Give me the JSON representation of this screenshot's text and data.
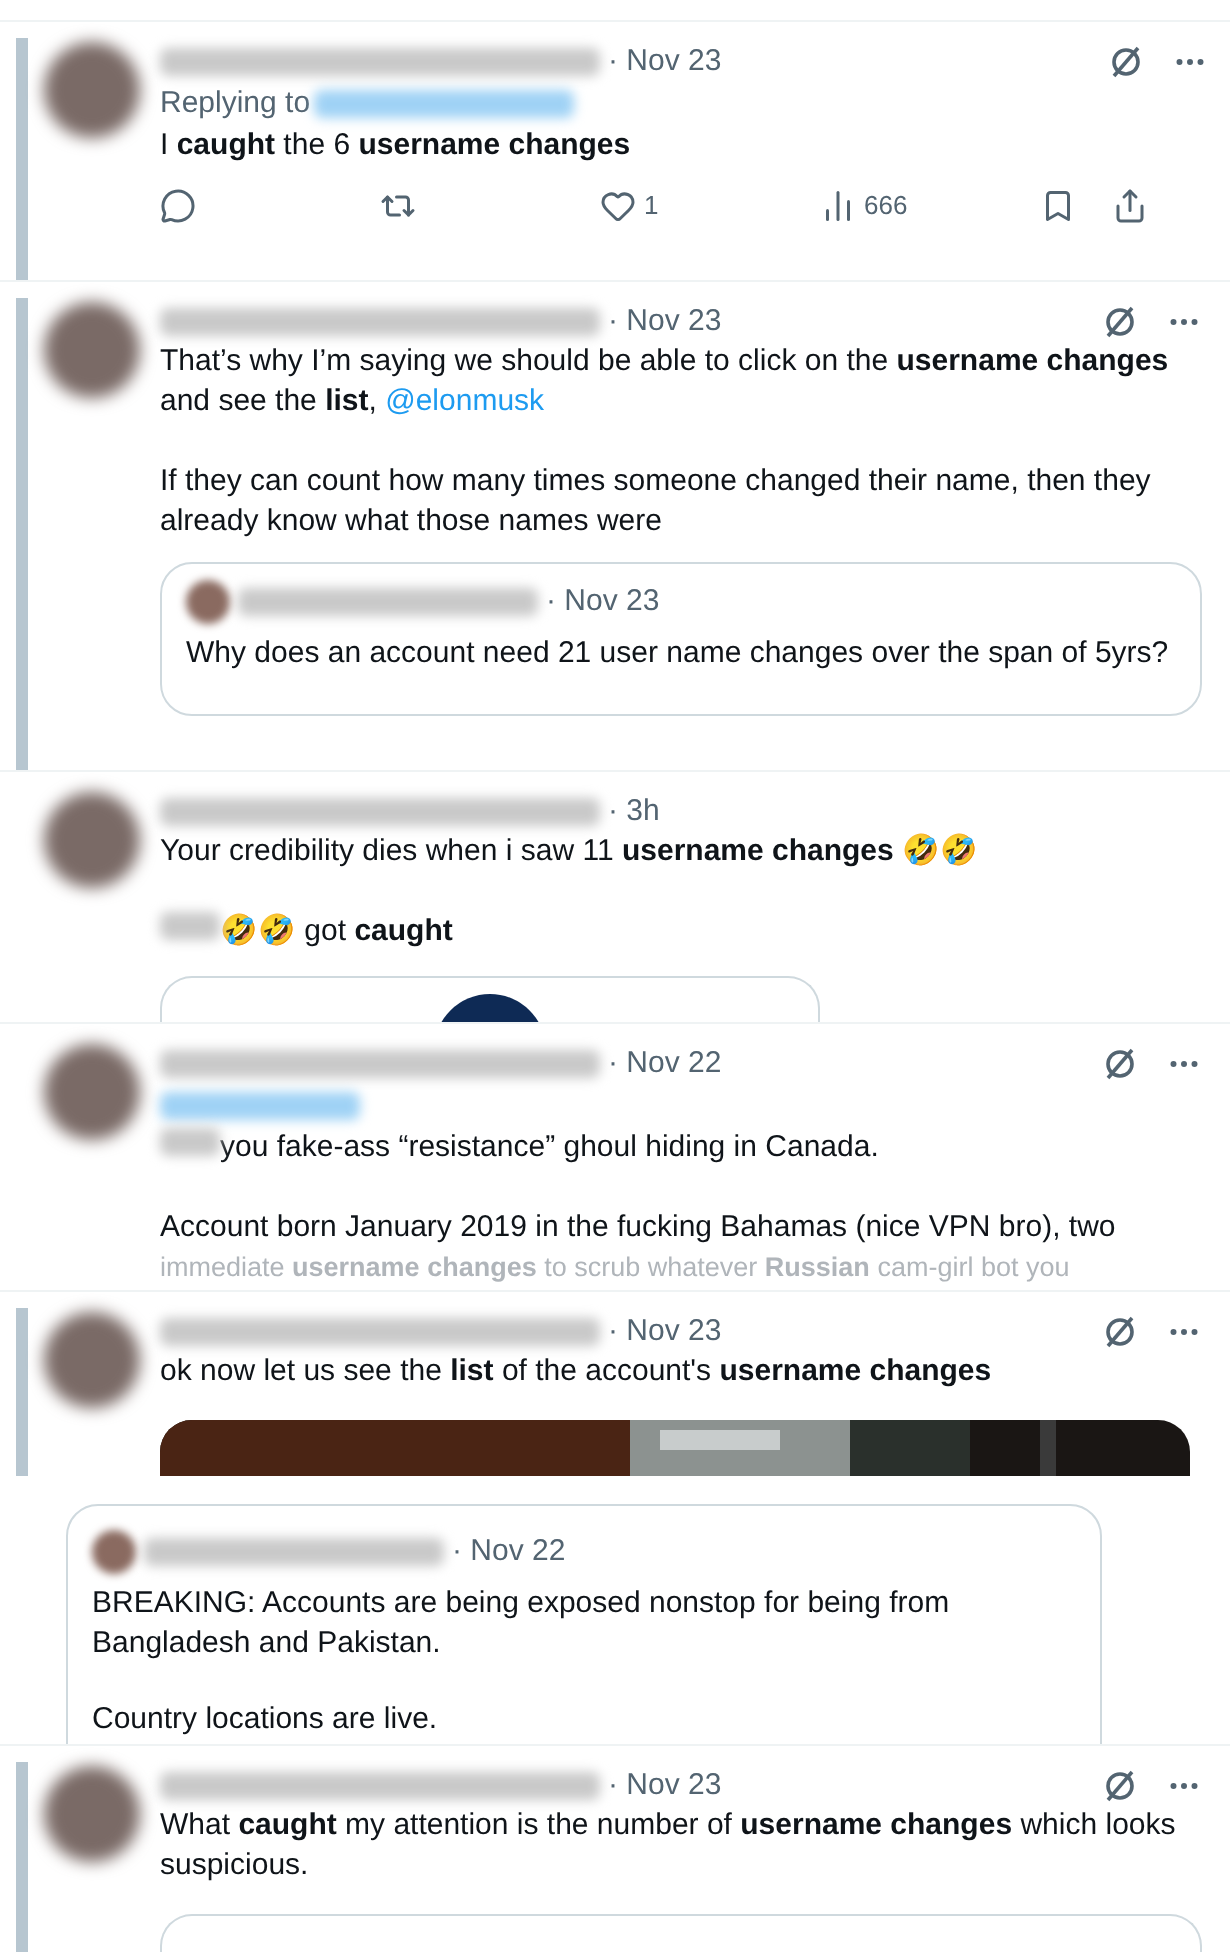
{
  "segments": [
    {
      "kind": "tweet",
      "bar": true,
      "menu": true,
      "date": "· Nov 23",
      "replying_to": "Replying to",
      "paragraphs": [
        {
          "kind": "text",
          "text": "I **caught** the 6 **username changes**"
        }
      ],
      "actions": [
        {
          "kind": "reply"
        },
        {
          "kind": "retweet"
        },
        {
          "kind": "like",
          "count": "1"
        },
        {
          "kind": "views",
          "count": "666"
        },
        {
          "kind": "bookmark"
        },
        {
          "kind": "share"
        }
      ]
    },
    {
      "kind": "tweet",
      "bar": true,
      "menu": true,
      "date": "· Nov 23",
      "paragraphs": [
        {
          "kind": "text",
          "text": "That’s why I’m saying we should be able to click on the **username changes** and see the **list**,",
          "link": "@elonmusk"
        },
        {
          "kind": "text",
          "text": "If they can count how many times someone changed their name, then they already know what those names were"
        }
      ],
      "embed": {
        "kind": "quote",
        "date": "· Nov 23",
        "text": "Why does an account need 21 user name changes over the span of 5yrs?"
      }
    },
    {
      "kind": "tweet",
      "bar": false,
      "menu": false,
      "date": "· 3h",
      "paragraphs": [
        {
          "kind": "text",
          "text": "Your credibility dies when i saw 11 **username changes** 🤣🤣"
        },
        {
          "kind": "mention",
          "text": "🤣🤣 got **caught**"
        }
      ],
      "embed": {
        "kind": "card"
      }
    },
    {
      "kind": "tweet",
      "bar": false,
      "menu": true,
      "date": "· Nov 22",
      "reply_blur": true,
      "paragraphs": [
        {
          "kind": "mention",
          "text": "you fake-ass “resistance” ghoul hiding in Canada."
        },
        {
          "kind": "text",
          "text": "Account born January 2019 in the fucking Bahamas (nice VPN bro), two"
        },
        {
          "kind": "faded",
          "text": "immediate **username changes** to scrub whatever **Russian** cam-girl bot you"
        }
      ]
    },
    {
      "kind": "tweet",
      "bar": true,
      "menu": true,
      "date": "· Nov 23",
      "paragraphs": [
        {
          "kind": "text",
          "text": "ok now let us see the **list** of the account's **username changes**"
        }
      ],
      "embed": {
        "kind": "picture"
      }
    },
    {
      "kind": "quote",
      "date": "· Nov 22",
      "paragraphs": [
        {
          "kind": "text",
          "text": "BREAKING: Accounts are being exposed nonstop for being from Bangladesh and Pakistan."
        },
        {
          "kind": "text",
          "text": "Country locations are live."
        }
      ]
    },
    {
      "kind": "tweet",
      "bar": true,
      "menu": true,
      "date": "· Nov 23",
      "paragraphs": [
        {
          "kind": "text",
          "text": "What **caught** my attention is the number of **username changes** which looks suspicious."
        }
      ],
      "embed": {
        "kind": "empty_card"
      }
    }
  ]
}
